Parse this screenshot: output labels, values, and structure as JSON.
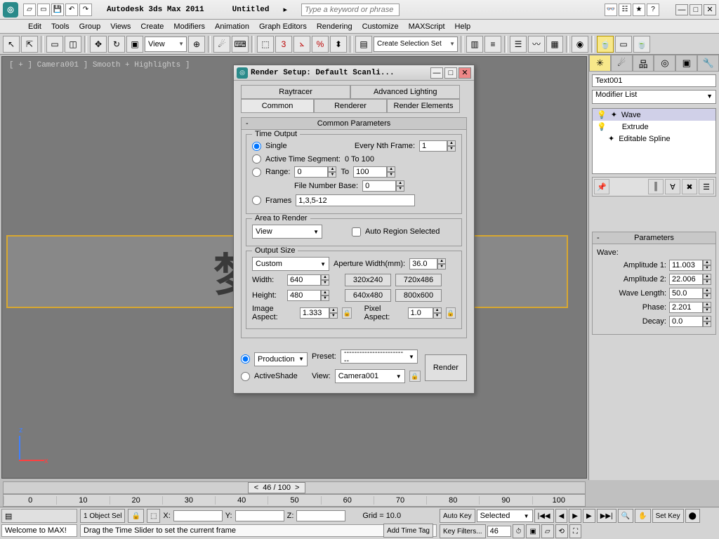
{
  "app": {
    "title": "Autodesk 3ds Max 2011",
    "doc": "Untitled",
    "search_placeholder": "Type a keyword or phrase"
  },
  "menus": [
    "Edit",
    "Tools",
    "Group",
    "Views",
    "Create",
    "Modifiers",
    "Animation",
    "Graph Editors",
    "Rendering",
    "Customize",
    "MAXScript",
    "Help"
  ],
  "toolbar": {
    "view_dd": "View",
    "selset": "Create Selection Set"
  },
  "viewport": {
    "label": "[ + ] Camera001 ] Smooth + Highlights ]",
    "text3d": "梦幻岛"
  },
  "dialog": {
    "title": "Render Setup: Default Scanli...",
    "tabs_row1": [
      "Raytracer",
      "Advanced Lighting"
    ],
    "tabs_row2": [
      "Common",
      "Renderer",
      "Render Elements"
    ],
    "section": "Common Parameters",
    "time_output": {
      "title": "Time Output",
      "single": "Single",
      "every_nth": "Every Nth Frame:",
      "every_nth_val": "1",
      "active": "Active Time Segment:",
      "active_range": "0 To 100",
      "range": "Range:",
      "range_from": "0",
      "range_to_lbl": "To",
      "range_to": "100",
      "file_base": "File Number Base:",
      "file_base_val": "0",
      "frames": "Frames",
      "frames_val": "1,3,5-12"
    },
    "area": {
      "title": "Area to Render",
      "view": "View",
      "auto": "Auto Region Selected"
    },
    "output": {
      "title": "Output Size",
      "preset": "Custom",
      "aperture_lbl": "Aperture Width(mm):",
      "aperture": "36.0",
      "width_lbl": "Width:",
      "width": "640",
      "height_lbl": "Height:",
      "height": "480",
      "presets": [
        "320x240",
        "720x486",
        "640x480",
        "800x600"
      ],
      "img_aspect_lbl": "Image Aspect:",
      "img_aspect": "1.333",
      "px_aspect_lbl": "Pixel Aspect:",
      "px_aspect": "1.0"
    },
    "foot": {
      "production": "Production",
      "activeshade": "ActiveShade",
      "preset_lbl": "Preset:",
      "preset_val": "-------------------------",
      "view_lbl": "View:",
      "view_val": "Camera001",
      "render": "Render"
    }
  },
  "panel": {
    "object_name": "Text001",
    "modlist": "Modifier List",
    "stack": [
      {
        "icon": "💡",
        "expand": "✦",
        "name": "Wave",
        "sel": true
      },
      {
        "icon": "💡",
        "expand": "",
        "name": "Extrude"
      },
      {
        "icon": "",
        "expand": "✦",
        "name": "Editable Spline"
      }
    ],
    "rollout": "Parameters",
    "wave_lbl": "Wave:",
    "params": [
      {
        "label": "Amplitude 1:",
        "val": "11.003"
      },
      {
        "label": "Amplitude 2:",
        "val": "22.006"
      },
      {
        "label": "Wave Length:",
        "val": "50.0"
      },
      {
        "label": "Phase:",
        "val": "2.201"
      },
      {
        "label": "Decay:",
        "val": "0.0"
      }
    ]
  },
  "time": {
    "current": "46 / 100",
    "ticks": [
      "0",
      "10",
      "20",
      "30",
      "40",
      "50",
      "60",
      "70",
      "80",
      "90",
      "100"
    ]
  },
  "status": {
    "welcome": "Welcome to MAX!",
    "sel": "1 Object Sel",
    "x": "X:",
    "y": "Y:",
    "z": "Z:",
    "grid": "Grid = 10.0",
    "prompt": "Drag the Time Slider to set the current frame",
    "add_tag": "Add Time Tag",
    "autokey": "Auto Key",
    "setkey": "Set Key",
    "selected": "Selected",
    "keyfilters": "Key Filters..."
  }
}
